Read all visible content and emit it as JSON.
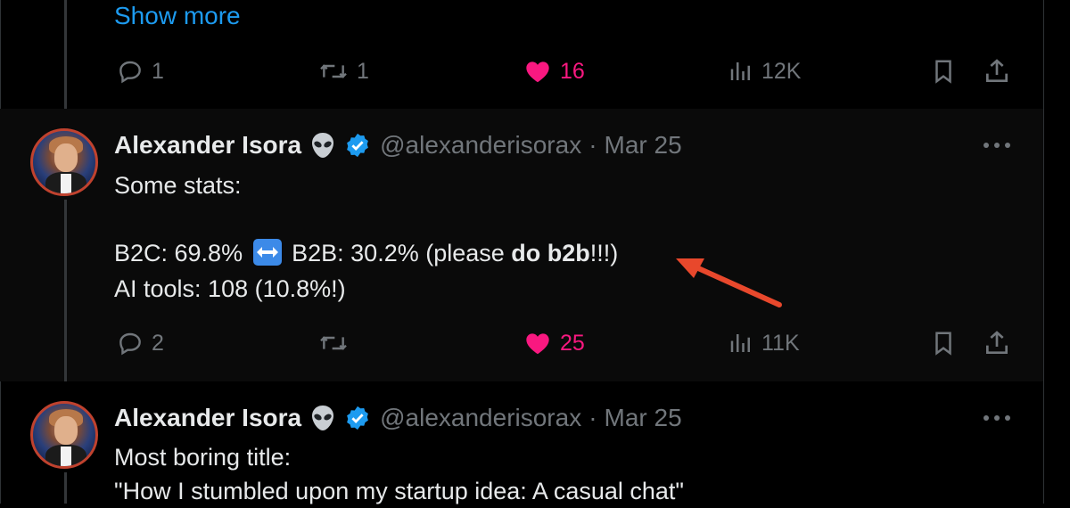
{
  "previous_tweet": {
    "show_more_label": "Show more",
    "actions": {
      "reply_count": "1",
      "retweet_count": "1",
      "like_count": "16",
      "view_count": "12K"
    }
  },
  "tweets": [
    {
      "author_name": "Alexander Isora",
      "author_emoji": "alien-emoji",
      "verified": true,
      "handle": "@alexanderisorax",
      "separator": "·",
      "date": "Mar 25",
      "lines": {
        "l1": "Some stats:",
        "l2_a": "B2C: 69.8%",
        "l2_b": "B2B: 30.2% (please",
        "l2_bold": "do b2b",
        "l2_c": "!!!)",
        "l3": "AI tools: 108 (10.8%!)"
      },
      "actions": {
        "reply_count": "2",
        "retweet_count": "",
        "like_count": "25",
        "view_count": "11K"
      }
    },
    {
      "author_name": "Alexander Isora",
      "author_emoji": "alien-emoji",
      "verified": true,
      "handle": "@alexanderisorax",
      "separator": "·",
      "date": "Mar 25",
      "lines": {
        "l1": "Most boring title:",
        "l2": "\"How I stumbled upon my startup idea: A casual chat\""
      }
    }
  ],
  "colors": {
    "background": "#000000",
    "highlighted_tweet_bg": "#0a0a0a",
    "link": "#1d9bf0",
    "like": "#f91880",
    "muted": "#71767b",
    "annotation_arrow": "#e8482c"
  }
}
